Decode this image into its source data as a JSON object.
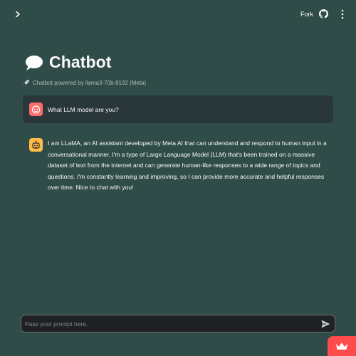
{
  "header": {
    "fork_label": "Fork",
    "icons": [
      "chevron-right-icon",
      "github-icon",
      "more-vertical-icon"
    ]
  },
  "page": {
    "title": "Chatbot",
    "title_icon": "speech-balloon-icon",
    "caption": "Chatbot powered by llama3-70b-8192 (Meta)",
    "caption_icon": "rocket-icon"
  },
  "messages": [
    {
      "role": "user",
      "avatar_icon": "user-avatar-icon",
      "text": "What LLM model are you?"
    },
    {
      "role": "assistant",
      "avatar_icon": "robot-avatar-icon",
      "text": "I am LLaMA, an AI assistant developed by Meta AI that can understand and respond to human input in a conversational manner. I'm a type of Large Language Model (LLM) that's been trained on a massive dataset of text from the internet and can generate human-like responses to a wide range of topics and questions. I'm constantly learning and improving, so I can provide more accurate and helpful responses over time. Nice to chat with you!"
    }
  ],
  "chat_input": {
    "placeholder": "Pass your prompt here.",
    "value": ""
  },
  "colors": {
    "background": "#2f4c48",
    "user_avatar": "#ff6c6c",
    "assistant_avatar": "#ffbd45",
    "badge": "#ff4b4b"
  }
}
